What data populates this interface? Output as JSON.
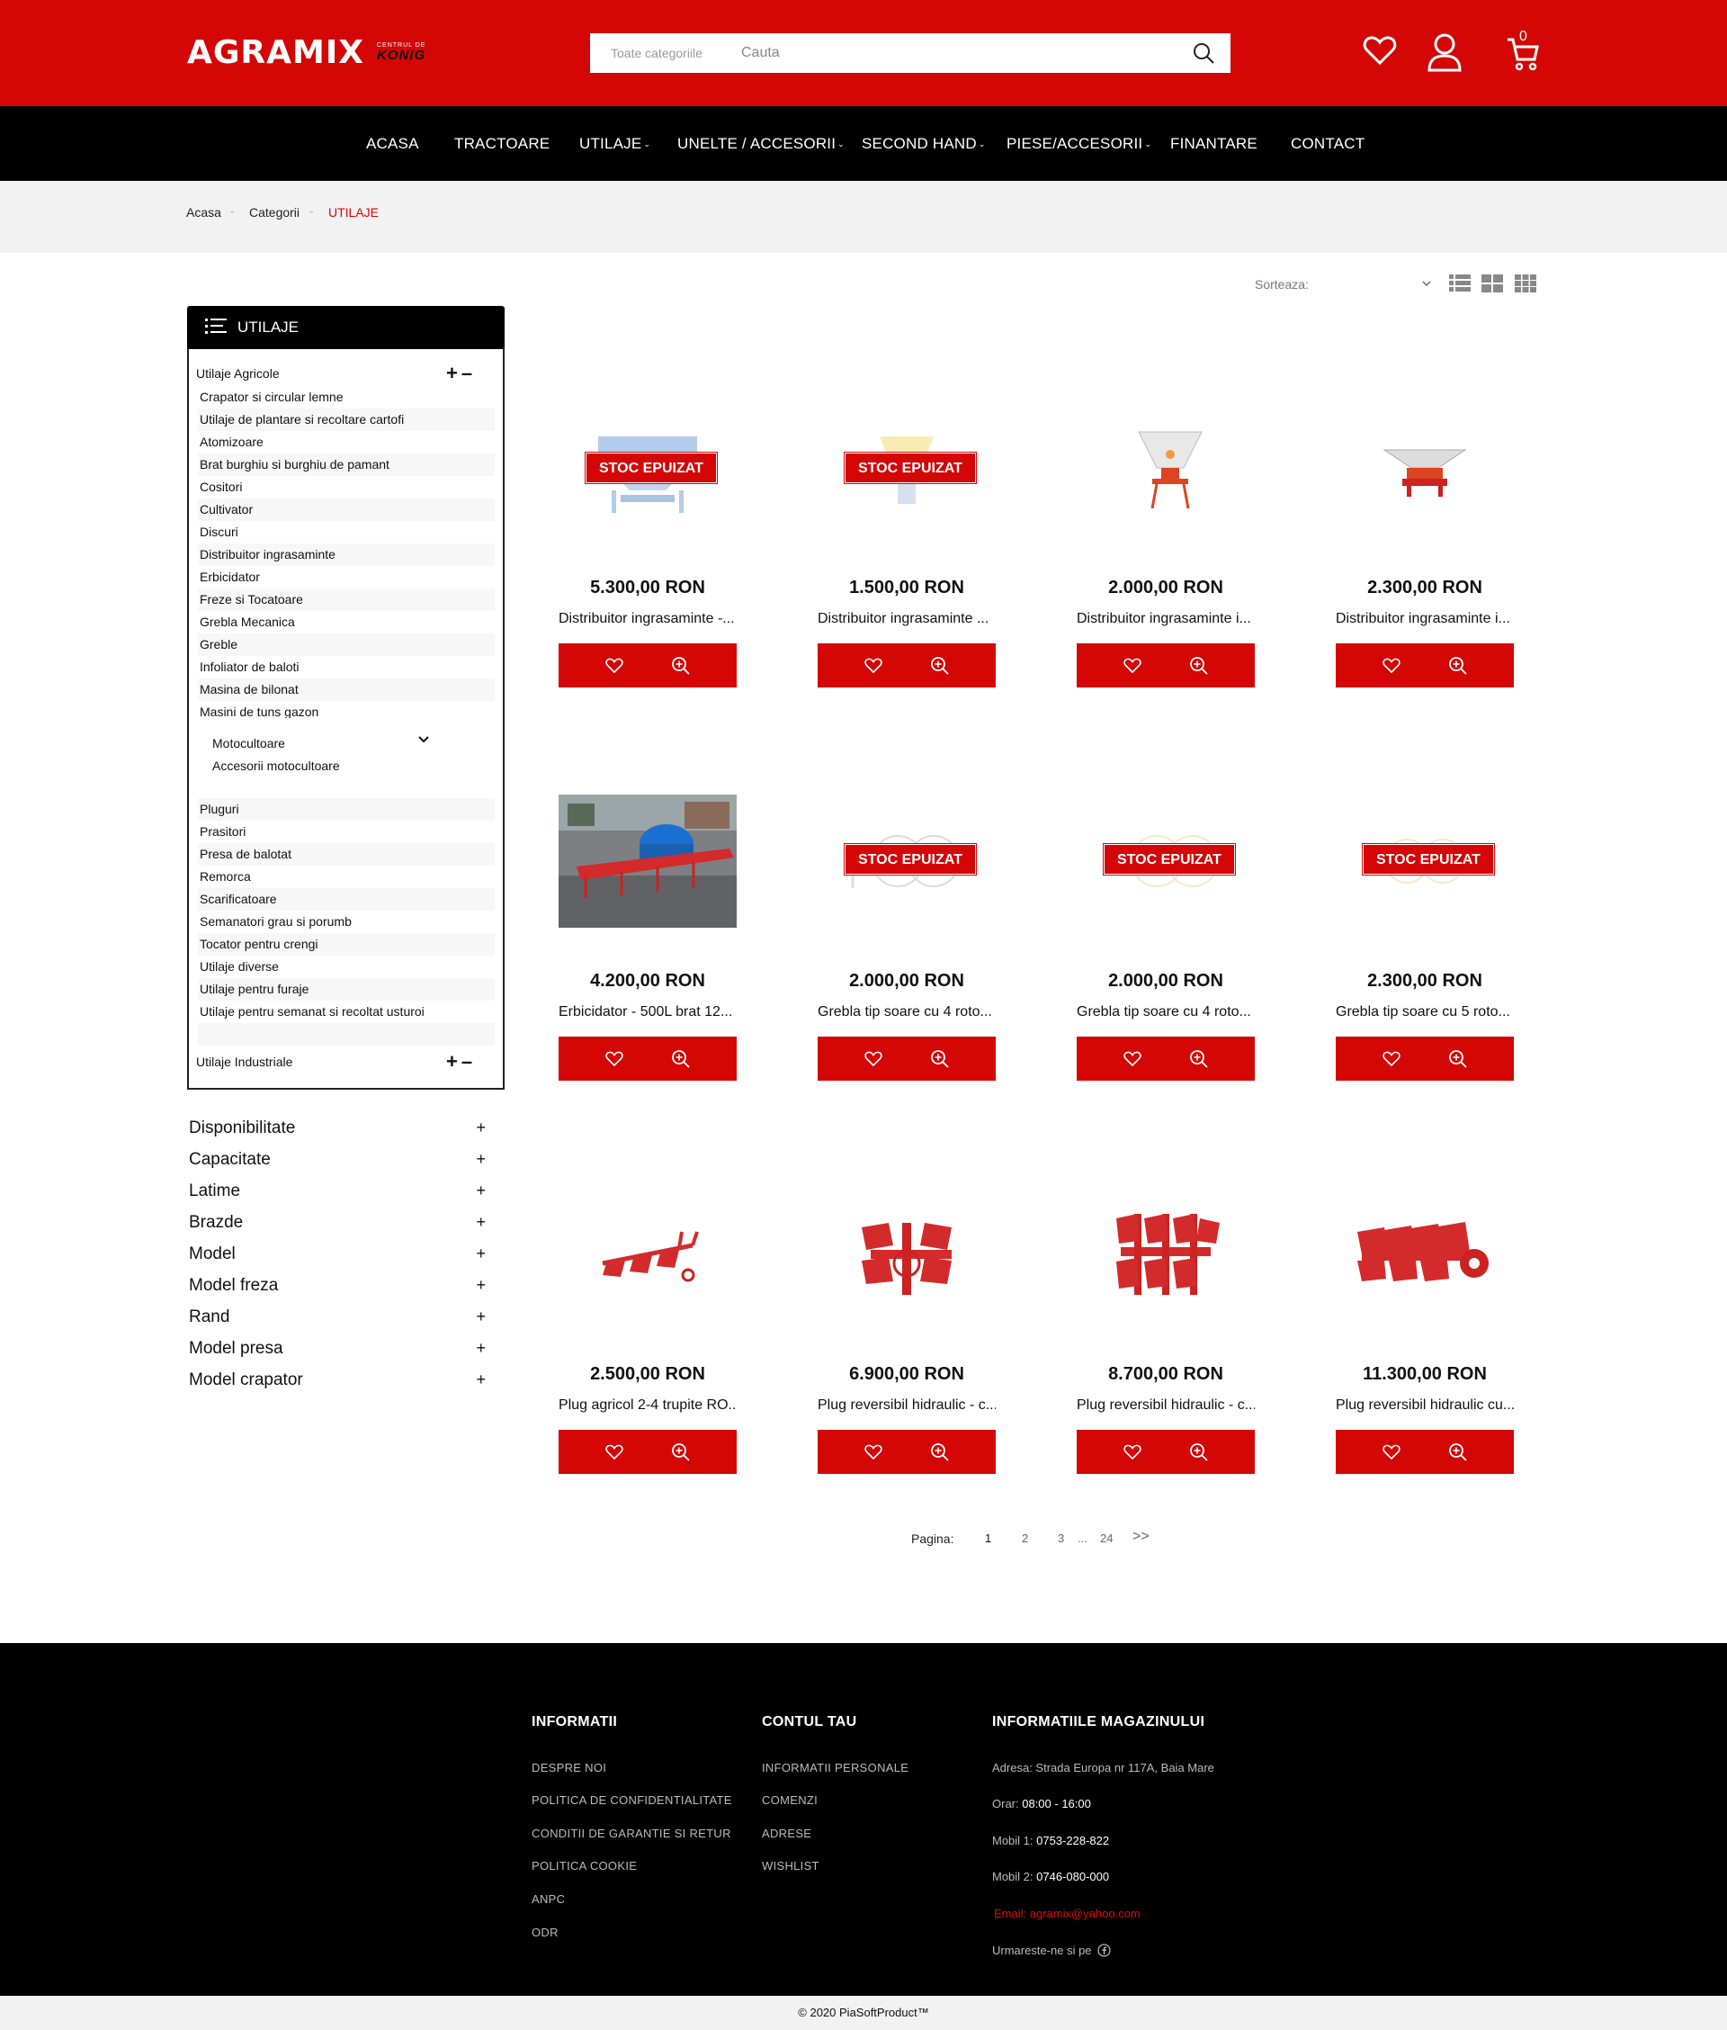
{
  "brand": {
    "logo_text": "AGRAMIX",
    "logo_sub1": "CENTRUL DE",
    "logo_sub2": "KONIG",
    "accent": "#d40606"
  },
  "search": {
    "category_label": "Toate categoriile",
    "placeholder": "Cauta"
  },
  "header_icons": [
    "heart-icon",
    "user-icon",
    "cart-icon"
  ],
  "cart": {
    "count": "0"
  },
  "nav": [
    {
      "label": "ACASA",
      "caret": false
    },
    {
      "label": "TRACTOARE",
      "caret": false
    },
    {
      "label": "UTILAJE",
      "caret": true
    },
    {
      "label": "UNELTE / ACCESORII",
      "caret": true
    },
    {
      "label": "SECOND HAND",
      "caret": true
    },
    {
      "label": "PIESE/ACCESORII",
      "caret": true
    },
    {
      "label": "FINANTARE",
      "caret": false
    },
    {
      "label": "CONTACT",
      "caret": false
    }
  ],
  "breadcrumb": [
    "Acasa",
    "Categorii",
    "UTILAJE"
  ],
  "sidebar": {
    "title": "UTILAJE",
    "group1": "Utilaje Agricole",
    "items_top": [
      "Crapator si circular lemne",
      "Utilaje de plantare si recoltare cartofi",
      "Atomizoare",
      "Brat burghiu si burghiu de pamant",
      "Cositori",
      "Cultivator",
      "Discuri",
      "Distribuitor ingrasaminte",
      "Erbicidator",
      "Freze si Tocatoare",
      "Grebla Mecanica",
      "Greble",
      "Infoliator de baloti",
      "Masina de bilonat",
      "Masini de tuns gazon"
    ],
    "moto": {
      "label": "Motocultoare",
      "sub": "Accesorii motocultoare"
    },
    "items_bottom": [
      "Pluguri",
      "Prasitori",
      "Presa de balotat",
      "Remorca",
      "Scarificatoare",
      "Semanatori grau si porumb",
      "Tocator pentru crengi",
      "Utilaje diverse",
      "Utilaje pentru furaje",
      "Utilaje pentru semanat si recoltat usturoi"
    ],
    "group2": "Utilaje Industriale"
  },
  "filters": [
    "Disponibilitate",
    "Capacitate",
    "Latime",
    "Brazde",
    "Model",
    "Model freza",
    "Rand",
    "Model presa",
    "Model crapator"
  ],
  "toolbar": {
    "sort_label": "Sorteaza:"
  },
  "products": [
    {
      "price": "5.300,00 RON",
      "name": "Distribuitor ingrasaminte -...",
      "badge": "STOC EPUIZAT",
      "image": "fertilizer-spreader-blue"
    },
    {
      "price": "1.500,00 RON",
      "name": "Distribuitor ingrasaminte ...",
      "badge": "STOC EPUIZAT",
      "image": "fertilizer-spreader-yellow"
    },
    {
      "price": "2.000,00 RON",
      "name": "Distribuitor ingrasaminte i...",
      "badge": "",
      "image": "fertilizer-spreader-white"
    },
    {
      "price": "2.300,00 RON",
      "name": "Distribuitor ingrasaminte i...",
      "badge": "",
      "image": "fertilizer-spreader-wide"
    },
    {
      "price": "4.200,00 RON",
      "name": "Erbicidator - 500L brat 12...",
      "badge": "",
      "image": "sprayer-photo"
    },
    {
      "price": "2.000,00 RON",
      "name": "Grebla tip soare cu 4 roto...",
      "badge": "STOC EPUIZAT",
      "image": "rake-4-rotors"
    },
    {
      "price": "2.000,00 RON",
      "name": "Grebla tip soare cu 4 roto...",
      "badge": "STOC EPUIZAT",
      "image": "rake-4-rotors-yellow"
    },
    {
      "price": "2.300,00 RON",
      "name": "Grebla tip soare cu 5 roto...",
      "badge": "STOC EPUIZAT",
      "image": "rake-5-rotors"
    },
    {
      "price": "2.500,00 RON",
      "name": "Plug agricol 2-4 trupite RO...",
      "badge": "",
      "image": "plough-small"
    },
    {
      "price": "6.900,00 RON",
      "name": "Plug reversibil hidraulic - c...",
      "badge": "",
      "image": "plough-reversible-2"
    },
    {
      "price": "8.700,00 RON",
      "name": "Plug reversibil hidraulic - c...",
      "badge": "",
      "image": "plough-reversible-3"
    },
    {
      "price": "11.300,00 RON",
      "name": "Plug reversibil hidraulic cu...",
      "badge": "",
      "image": "plough-reversible-4"
    }
  ],
  "pagination": {
    "label": "Pagina:",
    "pages": [
      "1",
      "2",
      "3",
      "...",
      "24"
    ],
    "next": ">>"
  },
  "footer": {
    "col1": {
      "title": "INFORMATII",
      "links": [
        "DESPRE NOI",
        "POLITICA DE CONFIDENTIALITATE",
        "CONDITII DE GARANTIE SI RETUR",
        "POLITICA COOKIE",
        "ANPC",
        "ODR"
      ]
    },
    "col2": {
      "title": "CONTUL TAU",
      "links": [
        "INFORMATII PERSONALE",
        "COMENZI",
        "ADRESE",
        "WISHLIST"
      ]
    },
    "col3": {
      "title": "INFORMATIILE MAGAZINULUI",
      "address": "Adresa: Strada Europa nr 117A, Baia Mare",
      "hours_label": "Orar: ",
      "hours": "08:00 - 16:00",
      "mobile1_label": "Mobil 1: ",
      "mobile1": "0753-228-822",
      "mobile2_label": "Mobil 2: ",
      "mobile2": "0746-080-000",
      "email": "Email: agramix@yahoo.com",
      "follow": "Urmareste-ne si pe"
    },
    "copyright": "© 2020 PiaSoftProduct™"
  }
}
